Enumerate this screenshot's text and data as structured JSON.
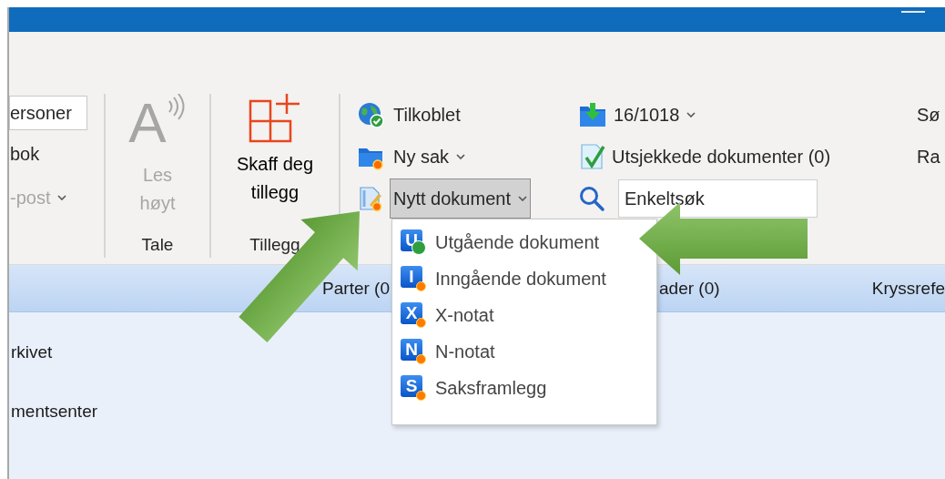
{
  "window": {
    "title_bar": {
      "minimize": true
    }
  },
  "ribbon": {
    "contacts_group": {
      "field_value": "ersoner",
      "items": [
        {
          "label": "bok",
          "disabled": false,
          "dropdown": false
        },
        {
          "label": "-post",
          "disabled": true,
          "dropdown": true
        }
      ]
    },
    "speech_group": {
      "icon_letter": "A",
      "button": {
        "label": "Les høyt",
        "disabled": true
      },
      "label": "Tale"
    },
    "addins_group": {
      "button": {
        "label": "Skaff deg tillegg",
        "disabled": false
      },
      "label": "Tillegg"
    },
    "case_group": {
      "column_1": [
        {
          "label": "Tilkoblet",
          "dropdown": false,
          "pressed": false
        },
        {
          "label": "Ny sak",
          "dropdown": true,
          "pressed": false
        },
        {
          "label": "Nytt dokument",
          "dropdown": true,
          "pressed": true
        }
      ],
      "column_2": [
        {
          "kind": "button",
          "label": "16/1018",
          "dropdown": true
        },
        {
          "kind": "button",
          "label": "Utsjekkede dokumenter (0)",
          "dropdown": false
        },
        {
          "kind": "search",
          "value": "Enkeltsøk"
        }
      ],
      "column_3": [
        "Sø",
        "Ra"
      ]
    }
  },
  "menu": {
    "items": [
      {
        "letter": "U",
        "kind": "check",
        "label": "Utgående dokument"
      },
      {
        "letter": "I",
        "kind": "new",
        "label": "Inngående dokument"
      },
      {
        "letter": "X",
        "kind": "new",
        "label": "X-notat"
      },
      {
        "letter": "N",
        "kind": "new",
        "label": "N-notat"
      },
      {
        "letter": "S",
        "kind": "new",
        "label": "Saksframlegg"
      }
    ]
  },
  "table": {
    "columns": [
      "Parter (0",
      "ader (0)",
      "Kryssrefe"
    ],
    "rows": [
      "rkivet",
      "mentsenter"
    ]
  }
}
